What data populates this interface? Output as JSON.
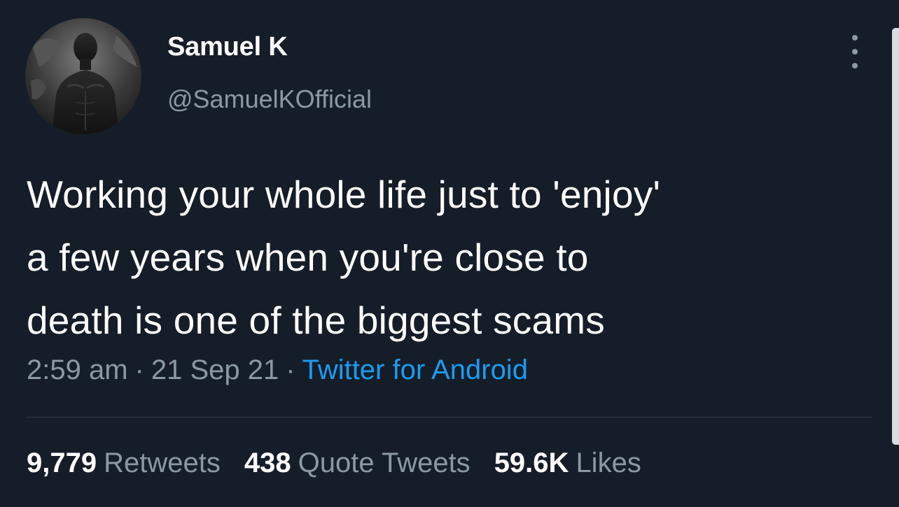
{
  "tweet": {
    "author": {
      "display_name": "Samuel K",
      "handle": "@SamuelKOfficial",
      "avatar_icon": "profile-photo"
    },
    "text_lines": [
      "Working your whole life just to 'enjoy'",
      "a few years when you're close to",
      "death is one of the biggest scams"
    ],
    "meta": {
      "time": "2:59 am",
      "separator": "·",
      "date": "21 Sep 21",
      "source": "Twitter for Android"
    },
    "stats": {
      "retweets_count": "9,779",
      "retweets_label": "Retweets",
      "quotes_count": "438",
      "quotes_label": "Quote Tweets",
      "likes_count": "59.6K",
      "likes_label": "Likes"
    },
    "more_icon": "more-vertical-icon"
  },
  "colors": {
    "background": "#151d28",
    "text_primary": "#ffffff",
    "text_secondary": "#8b98a5",
    "link": "#1d9bf0",
    "divider": "#303a45"
  }
}
